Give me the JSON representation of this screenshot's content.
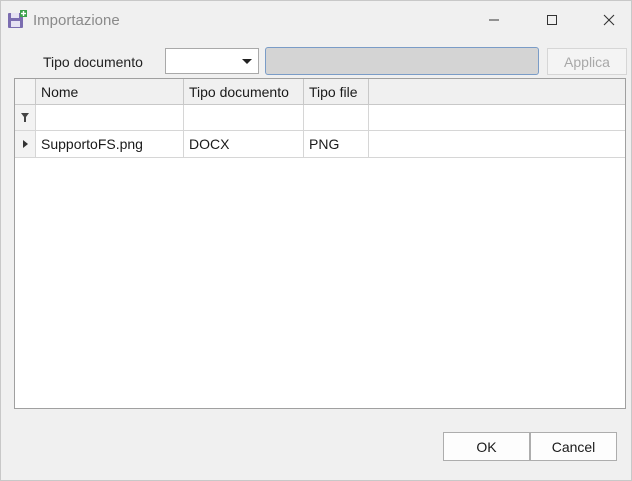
{
  "window": {
    "title": "Importazione"
  },
  "toolbar": {
    "tipo_documento_label": "Tipo documento",
    "tipo_documento_value": "",
    "filter_text_value": "",
    "apply_label": "Applica"
  },
  "grid": {
    "columns": [
      "Nome",
      "Tipo documento",
      "Tipo file"
    ],
    "rows": [
      {
        "nome": "SupportoFS.png",
        "tipo_documento": "DOCX",
        "tipo_file": "PNG"
      }
    ]
  },
  "footer": {
    "ok_label": "OK",
    "cancel_label": "Cancel"
  },
  "colors": {
    "background": "#f0f0f0",
    "disabled_input": "#d4d4d4",
    "focus_border": "#7a9cc7",
    "icon_purple": "#7b6db0",
    "icon_green": "#3aa04a"
  }
}
